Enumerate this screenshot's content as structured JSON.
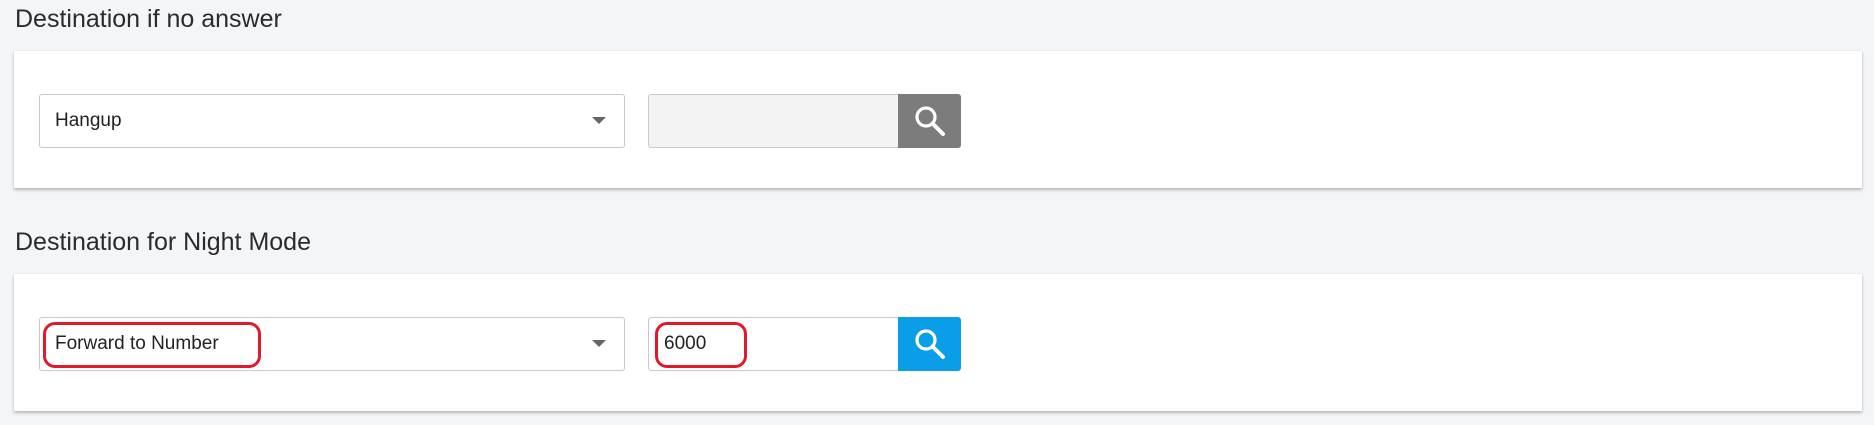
{
  "sections": [
    {
      "title": "Destination if no answer",
      "destination_type": "Hangup",
      "destination_value": "",
      "search_icon": "search-icon",
      "search_enabled": false
    },
    {
      "title": "Destination for Night Mode",
      "destination_type": "Forward to Number",
      "destination_value": "6000",
      "search_icon": "search-icon",
      "search_enabled": true
    }
  ],
  "colors": {
    "search_active": "#0a9ee8",
    "search_disabled": "#7c7c7c",
    "highlight": "#e0192b"
  }
}
